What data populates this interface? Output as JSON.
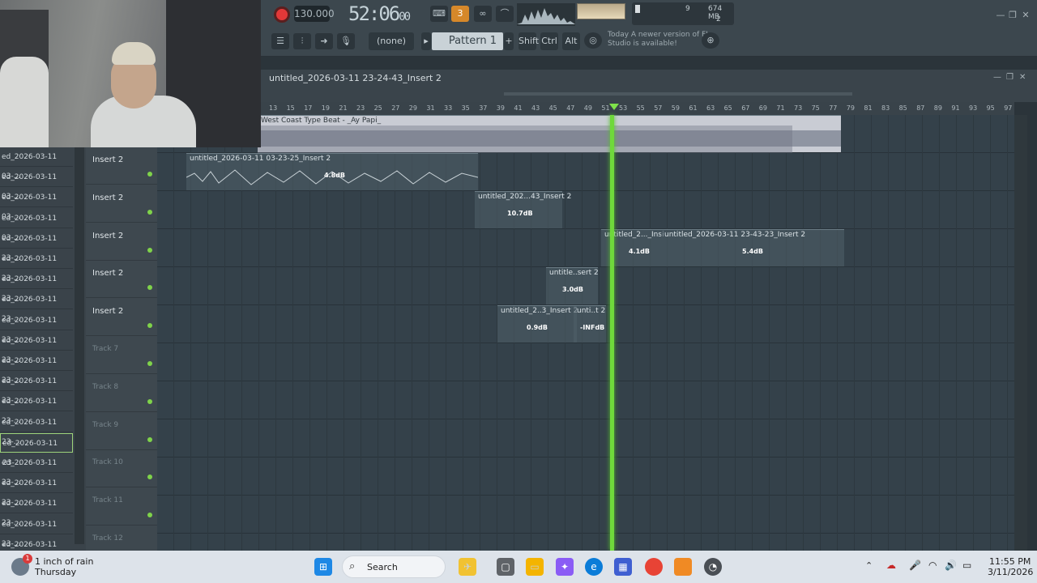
{
  "toolbar": {
    "tempo": "130.000",
    "time": "52:06",
    "time_sub": "00",
    "cpu_value": "9",
    "ram": "674 MB",
    "voices": "2",
    "pattern_select": "(none)",
    "pattern": "Pattern 1",
    "shift": "Shift",
    "ctrl": "Ctrl",
    "alt": "Alt",
    "hint_today": "Today",
    "hint_msg": "A newer version of FL Studio is available!"
  },
  "playlist": {
    "title": "untitled_2026-03-11 23-24-43_Insert 2",
    "ruler": [
      "13",
      "15",
      "17",
      "19",
      "21",
      "23",
      "25",
      "27",
      "29",
      "31",
      "33",
      "35",
      "37",
      "39",
      "41",
      "43",
      "45",
      "47",
      "49",
      "51",
      "53",
      "55",
      "57",
      "59",
      "61",
      "63",
      "65",
      "67",
      "69",
      "71",
      "73",
      "75",
      "77",
      "79",
      "81",
      "83",
      "85",
      "87",
      "89",
      "91",
      "93",
      "95",
      "97"
    ],
    "top_clip": "West Coast Type Beat - _Ay Papi_",
    "clips": [
      {
        "label": "untitled_2026-03-11 03-23-25_Insert 2",
        "db": "4.8dB"
      },
      {
        "label": "untitled_202...43_Insert 2",
        "db": "10.7dB"
      },
      {
        "label": "untitled_2..._Insi",
        "db": "4.1dB"
      },
      {
        "label": "untitled_2026-03-11 23-43-23_Insert 2",
        "db": "5.4dB"
      },
      {
        "label": "untitle..sert 2",
        "db": "3.0dB"
      },
      {
        "label": "untitled_2..3_Insert 2",
        "db": "0.9dB"
      },
      {
        "label": "unti..t 2",
        "db": "-INFdB"
      }
    ]
  },
  "browser": [
    "ed_2026-03-11 03-...",
    "ed_2026-03-11 03-...",
    "ed_2026-03-11 03-...",
    "ed_2026-03-11 03-...",
    "ed_2026-03-11 23-...",
    "ed_2026-03-11 23-...",
    "ed_2026-03-11 23-...",
    "ed_2026-03-11 23-...",
    "ed_2026-03-11 23-...",
    "ed_2026-03-11 23-...",
    "ed_2026-03-11 23-...",
    "ed_2026-03-11 23-...",
    "ed_2026-03-11 23-...",
    "ed_2026-03-11 23-...",
    "ed_2026-03-11 23-...",
    "ed_2026-03-11 23-...",
    "ed_2026-03-11 23-...",
    "ed_2026-03-11 23-...",
    "ed_2026-03-11 23-...",
    "ed_2026-03-11 23-..."
  ],
  "tracks": [
    {
      "name": "Insert 2"
    },
    {
      "name": "Insert 2"
    },
    {
      "name": "Insert 2"
    },
    {
      "name": "Insert 2"
    },
    {
      "name": "Insert 2"
    },
    {
      "name": "Track 7"
    },
    {
      "name": "Track 8"
    },
    {
      "name": "Track 9"
    },
    {
      "name": "Track 10"
    },
    {
      "name": "Track 11"
    },
    {
      "name": "Track 12"
    }
  ],
  "taskbar": {
    "weather": "1 inch of rain",
    "weather_day": "Thursday",
    "weather_badge": "1",
    "search": "Search",
    "time": "11:55 PM",
    "date": "3/11/2026"
  }
}
